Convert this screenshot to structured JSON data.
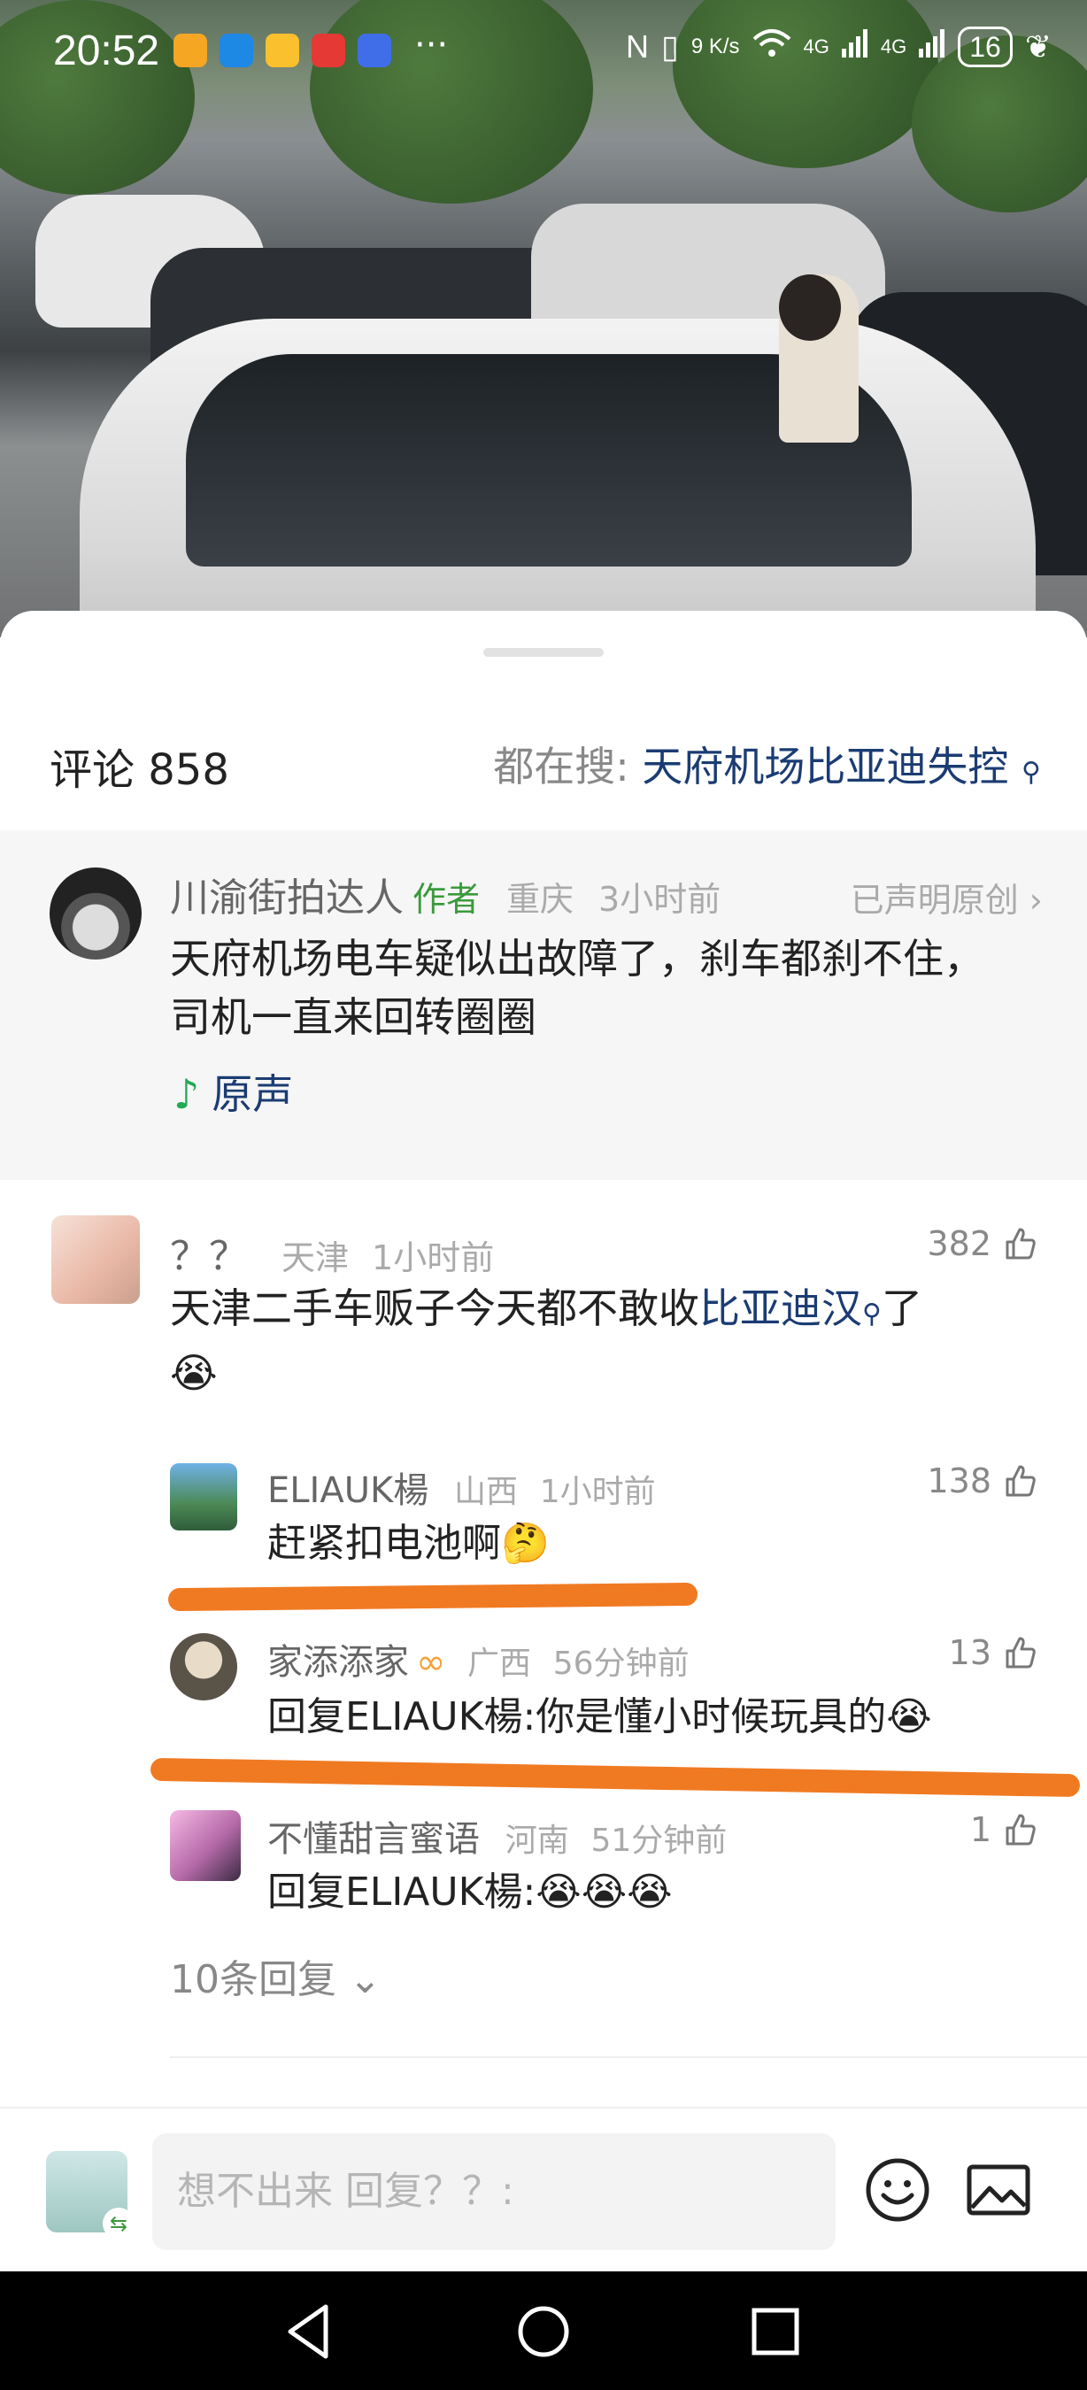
{
  "status_bar": {
    "time": "20:52",
    "more": "···",
    "net_speed": "9 K/s",
    "signal_a": "4G",
    "signal_b": "4G",
    "battery": "16"
  },
  "comments_header": {
    "label": "评论 858",
    "search_prefix": "都在搜:",
    "search_keyword": "天府机场比亚迪失控"
  },
  "pinned_post": {
    "author": "川渝街拍达人",
    "author_tag": "作者",
    "location": "重庆",
    "time": "3小时前",
    "declared": "已声明原创 ›",
    "text_line1": "天府机场电车疑似出故障了，刹车都刹不住，",
    "text_line2": "司机一直来回转圈圈",
    "music": "原声"
  },
  "comments": [
    {
      "user": "？？",
      "location": "天津",
      "time": "1小时前",
      "likes": "382",
      "text_before": "天津二手车贩子今天都不敢收",
      "text_link": "比亚迪汉",
      "text_after": "了",
      "emoji": "😭"
    }
  ],
  "replies": [
    {
      "user": "ELIAUK楊",
      "location": "山西",
      "time": "1小时前",
      "likes": "138",
      "text": "赶紧扣电池啊",
      "emoji": "🤔"
    },
    {
      "user": "家添添家",
      "location": "广西",
      "time": "56分钟前",
      "likes": "13",
      "text": "回复ELIAUK楊:你是懂小时候玩具的",
      "emoji": "😭"
    },
    {
      "user": "不懂甜言蜜语",
      "location": "河南",
      "time": "51分钟前",
      "likes": "1",
      "text": "回复ELIAUK楊:",
      "emoji": "😭😭😭"
    }
  ],
  "expand_replies": "10条回复 ⌄",
  "composer": {
    "placeholder": "想不出来 回复？？:"
  },
  "colors": {
    "accent_link": "#1b3c73",
    "author_tag": "#3a9a3a",
    "annotation_stroke": "#f07a22"
  }
}
